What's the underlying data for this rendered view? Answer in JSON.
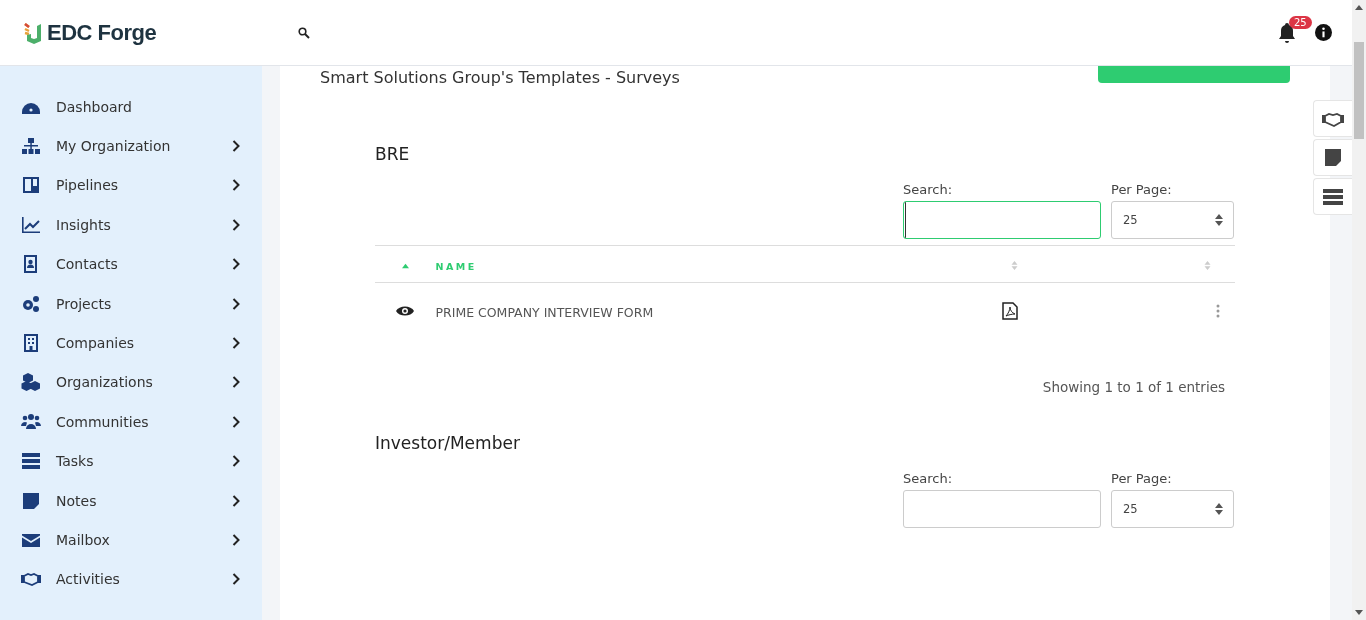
{
  "header": {
    "brand": "EDC Forge",
    "notification_count": "25"
  },
  "sidebar": {
    "items": [
      {
        "label": "Dashboard",
        "has_submenu": false
      },
      {
        "label": "My Organization",
        "has_submenu": true
      },
      {
        "label": "Pipelines",
        "has_submenu": true
      },
      {
        "label": "Insights",
        "has_submenu": true
      },
      {
        "label": "Contacts",
        "has_submenu": true
      },
      {
        "label": "Projects",
        "has_submenu": true
      },
      {
        "label": "Companies",
        "has_submenu": true
      },
      {
        "label": "Organizations",
        "has_submenu": true
      },
      {
        "label": "Communities",
        "has_submenu": true
      },
      {
        "label": "Tasks",
        "has_submenu": true
      },
      {
        "label": "Notes",
        "has_submenu": true
      },
      {
        "label": "Mailbox",
        "has_submenu": true
      },
      {
        "label": "Activities",
        "has_submenu": true
      }
    ]
  },
  "page": {
    "title": "Smart Solutions Group's Templates - Surveys"
  },
  "sections": [
    {
      "title": "BRE",
      "search": {
        "label": "Search:",
        "focused": true
      },
      "per_page": {
        "label": "Per Page:",
        "value": "25"
      },
      "columns": [
        {
          "label": "NAME"
        }
      ],
      "rows": [
        {
          "name": "PRIME COMPANY INTERVIEW FORM"
        }
      ],
      "info": "Showing 1 to 1 of 1 entries"
    },
    {
      "title": "Investor/Member",
      "search": {
        "label": "Search:",
        "focused": false
      },
      "per_page": {
        "label": "Per Page:",
        "value": "25"
      }
    }
  ]
}
